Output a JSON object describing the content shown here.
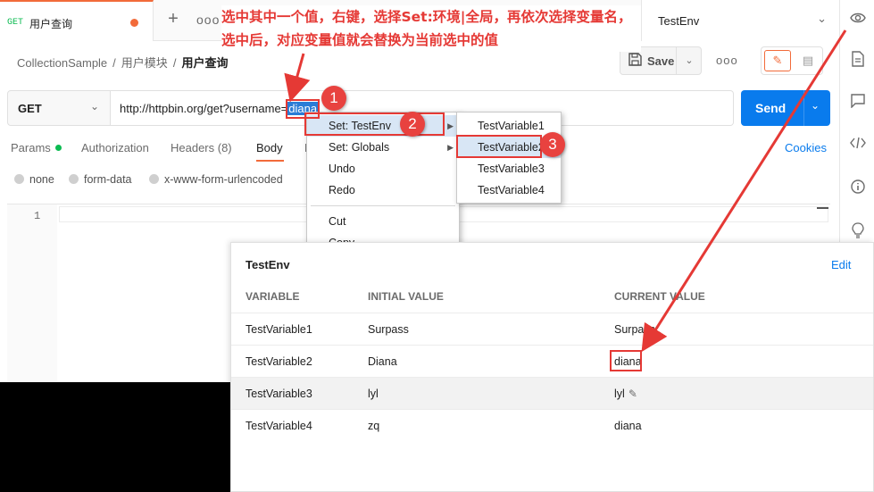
{
  "tab": {
    "method": "GET",
    "title": "用户查询"
  },
  "tabbar": {
    "add": "+",
    "more": "ooo"
  },
  "environment": {
    "selected": "TestEnv",
    "chevron": "⌄"
  },
  "breadcrumb": {
    "collection": "CollectionSample",
    "folder": "用户模块",
    "request": "用户查询",
    "separator": "/"
  },
  "toolbar": {
    "save_label": "Save",
    "save_icon": "floppy-icon",
    "more": "ooo"
  },
  "request": {
    "method": "GET",
    "url_prefix": "http://httpbin.org/get?username=",
    "url_selected": "diana",
    "send_label": "Send"
  },
  "request_tabs": [
    {
      "label": "Params"
    },
    {
      "label": "Authorization"
    },
    {
      "label": "Headers (8)"
    },
    {
      "label": "Body"
    },
    {
      "label": "P"
    }
  ],
  "cookies_label": "Cookies",
  "body_types": [
    "none",
    "form-data",
    "x-www-form-urlencoded"
  ],
  "editor": {
    "line_number": "1"
  },
  "context_menu": {
    "items": [
      "Set: TestEnv",
      "Set: Globals",
      "Undo",
      "Redo",
      "Cut",
      "Copy"
    ],
    "submenu": [
      "TestVariable1",
      "TestVariable2",
      "TestVariable3",
      "TestVariable4"
    ]
  },
  "annotation": {
    "note": "选中其中一个值，右键，选择Set:环境|全局，再依次选择变量名，选中后，对应变量值就会替换为当前选中的值",
    "badges": [
      "1",
      "2",
      "3"
    ],
    "color": "#e53935"
  },
  "env_popup": {
    "title": "TestEnv",
    "edit_label": "Edit",
    "columns": [
      "VARIABLE",
      "INITIAL VALUE",
      "CURRENT VALUE"
    ],
    "rows": [
      {
        "variable": "TestVariable1",
        "initial": "Surpass",
        "current": "Surpass"
      },
      {
        "variable": "TestVariable2",
        "initial": "Diana",
        "current": "diana"
      },
      {
        "variable": "TestVariable3",
        "initial": "lyl",
        "current": "lyl"
      },
      {
        "variable": "TestVariable4",
        "initial": "zq",
        "current": "diana"
      }
    ]
  },
  "colors": {
    "accent": "#f26b3a",
    "send": "#097bed",
    "link": "#097bed",
    "status_green": "#0cbb52"
  }
}
